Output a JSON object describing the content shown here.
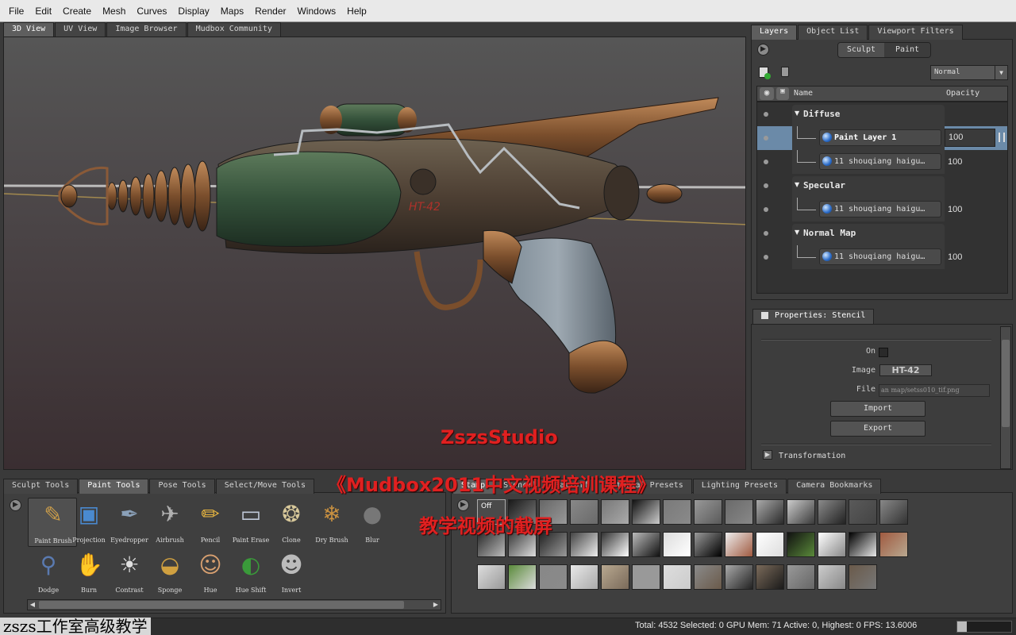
{
  "menu": [
    "File",
    "Edit",
    "Create",
    "Mesh",
    "Curves",
    "Display",
    "Maps",
    "Render",
    "Windows",
    "Help"
  ],
  "view_tabs": [
    "3D View",
    "UV View",
    "Image Browser",
    "Mudbox Community"
  ],
  "viewport": {
    "decal_text": "HT-42",
    "watermark": [
      "ZszsStudio",
      "《Mudbox2011中文视频培训课程》",
      "教学视频的截屏"
    ]
  },
  "right_tabs": [
    "Layers",
    "Object List",
    "Viewport Filters"
  ],
  "mode": {
    "sculpt": "Sculpt",
    "paint": "Paint",
    "active": "Paint"
  },
  "blend_mode": "Normal",
  "layer_table": {
    "headers": {
      "name": "Name",
      "opacity": "Opacity"
    },
    "rows": [
      {
        "type": "group",
        "name": "Diffuse"
      },
      {
        "type": "layer",
        "name": "Paint Layer 1",
        "opacity": "100",
        "selected": true
      },
      {
        "type": "layer",
        "name": "11 shouqiang haigu…",
        "opacity": "100"
      },
      {
        "type": "group",
        "name": "Specular"
      },
      {
        "type": "layer",
        "name": "11 shouqiang haigu…",
        "opacity": "100"
      },
      {
        "type": "group",
        "name": "Normal Map"
      },
      {
        "type": "layer",
        "name": "11 shouqiang haigu…",
        "opacity": "100"
      }
    ]
  },
  "properties": {
    "title": "Properties: Stencil",
    "on_label": "On",
    "image_label": "Image",
    "image_value": "HT-42",
    "file_label": "File",
    "file_value": "an map/setss010_tif.png",
    "import": "Import",
    "export": "Export",
    "transformation": "Transformation"
  },
  "tool_tabs": [
    "Sculpt Tools",
    "Paint Tools",
    "Pose Tools",
    "Select/Move Tools"
  ],
  "active_tool_tab": "Paint Tools",
  "tools": [
    "Paint Brush",
    "Projection",
    "Eyedropper",
    "Airbrush",
    "Pencil",
    "Paint Erase",
    "Clone",
    "Dry Brush",
    "Blur",
    "Dodge",
    "Burn",
    "Contrast",
    "Sponge",
    "Hue",
    "Hue Shift",
    "Invert"
  ],
  "tray_tabs": [
    "Stamp",
    "Stencil",
    "Falloff",
    "Material Presets",
    "Lighting Presets",
    "Camera Bookmarks"
  ],
  "stamp_off_label": "Off",
  "status": "Total: 4532  Selected: 0 GPU Mem: 71  Active: 0, Highest: 0  FPS: 13.6006",
  "bottom_watermark": "zszs工作室高级教学"
}
